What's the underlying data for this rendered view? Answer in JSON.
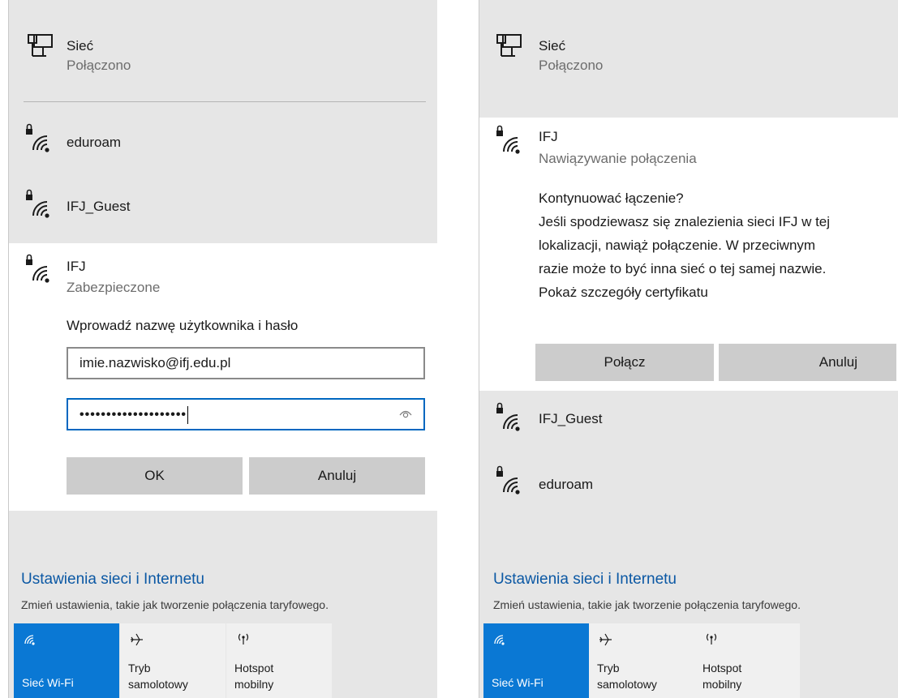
{
  "left": {
    "network": {
      "title": "Sieć",
      "status": "Połączono"
    },
    "wifi_items": [
      {
        "ssid": "eduroam"
      },
      {
        "ssid": "IFJ_Guest"
      }
    ],
    "expanded": {
      "ssid": "IFJ",
      "status": "Zabezpieczone",
      "prompt": "Wprowadź nazwę użytkownika i hasło",
      "username_value": "imie.nazwisko@ifj.edu.pl",
      "password_mask": "••••••••••••••••••••",
      "ok_label": "OK",
      "cancel_label": "Anuluj"
    },
    "settings": {
      "link": "Ustawienia sieci i Internetu",
      "desc": "Zmień ustawienia, takie jak tworzenie połączenia taryfowego."
    },
    "tiles": [
      {
        "label1": "Sieć Wi-Fi",
        "label2": "",
        "icon": "wifi-icon"
      },
      {
        "label1": "Tryb",
        "label2": "samolotowy",
        "icon": "airplane-icon"
      },
      {
        "label1": "Hotspot",
        "label2": "mobilny",
        "icon": "hotspot-icon"
      }
    ]
  },
  "right": {
    "network": {
      "title": "Sieć",
      "status": "Połączono"
    },
    "expanded": {
      "ssid": "IFJ",
      "status": "Nawiązywanie połączenia",
      "message_lines": [
        "Kontynuować łączenie?",
        "Jeśli spodziewasz się znalezienia sieci IFJ w tej",
        "lokalizacji, nawiąż połączenie. W przeciwnym",
        "razie może to być inna sieć o tej samej nazwie.",
        "Pokaż szczegóły certyfikatu"
      ],
      "connect_label": "Połącz",
      "cancel_label": "Anuluj"
    },
    "wifi_items": [
      {
        "ssid": "IFJ_Guest"
      },
      {
        "ssid": "eduroam"
      }
    ],
    "settings": {
      "link": "Ustawienia sieci i Internetu",
      "desc": "Zmień ustawienia, takie jak tworzenie połączenia taryfowego."
    },
    "tiles": [
      {
        "label1": "Sieć Wi-Fi",
        "label2": "",
        "icon": "wifi-icon"
      },
      {
        "label1": "Tryb",
        "label2": "samolotowy",
        "icon": "airplane-icon"
      },
      {
        "label1": "Hotspot",
        "label2": "mobilny",
        "icon": "hotspot-icon"
      }
    ]
  },
  "colors": {
    "accent": "#0a78d4",
    "link": "#0b58a4",
    "flyout_bg": "#e6e6e6"
  }
}
